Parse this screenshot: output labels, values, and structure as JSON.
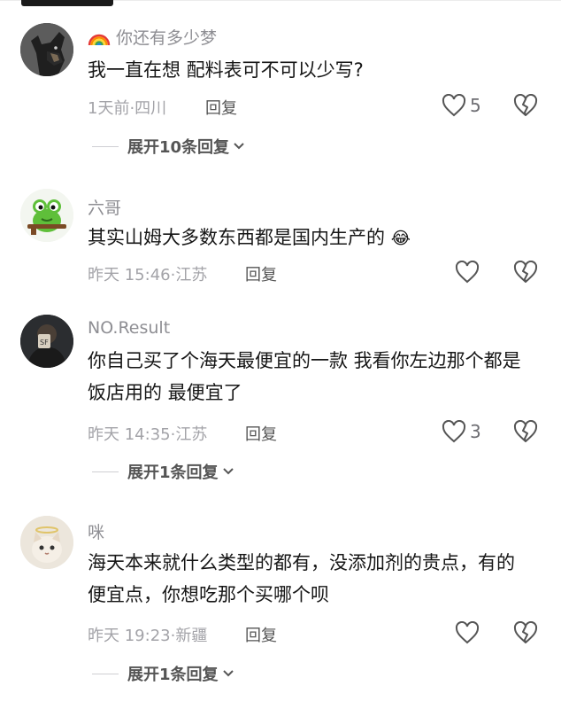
{
  "comments": [
    {
      "username": "你还有多少梦",
      "content": "我一直在想 配料表可不可以少写?",
      "time_location": "1天前·四川",
      "reply_label": "回复",
      "likes": "5",
      "expand_label": "展开10条回复"
    },
    {
      "username": "六哥",
      "content": "其实山姆大多数东西都是国内生产的",
      "emoji": "😂",
      "time_location": "昨天 15:46·江苏",
      "reply_label": "回复",
      "likes": ""
    },
    {
      "username": "NO.Result",
      "content": "你自己买了个海天最便宜的一款 我看你左边那个都是饭店用的 最便宜了",
      "time_location": "昨天 14:35·江苏",
      "reply_label": "回复",
      "likes": "3",
      "expand_label": "展开1条回复"
    },
    {
      "username": "咪",
      "content": "海天本来就什么类型的都有，没添加剂的贵点，有的便宜点，你想吃那个买哪个呗",
      "time_location": "昨天 19:23·新疆",
      "reply_label": "回复",
      "likes": "",
      "expand_label": "展开1条回复"
    }
  ]
}
